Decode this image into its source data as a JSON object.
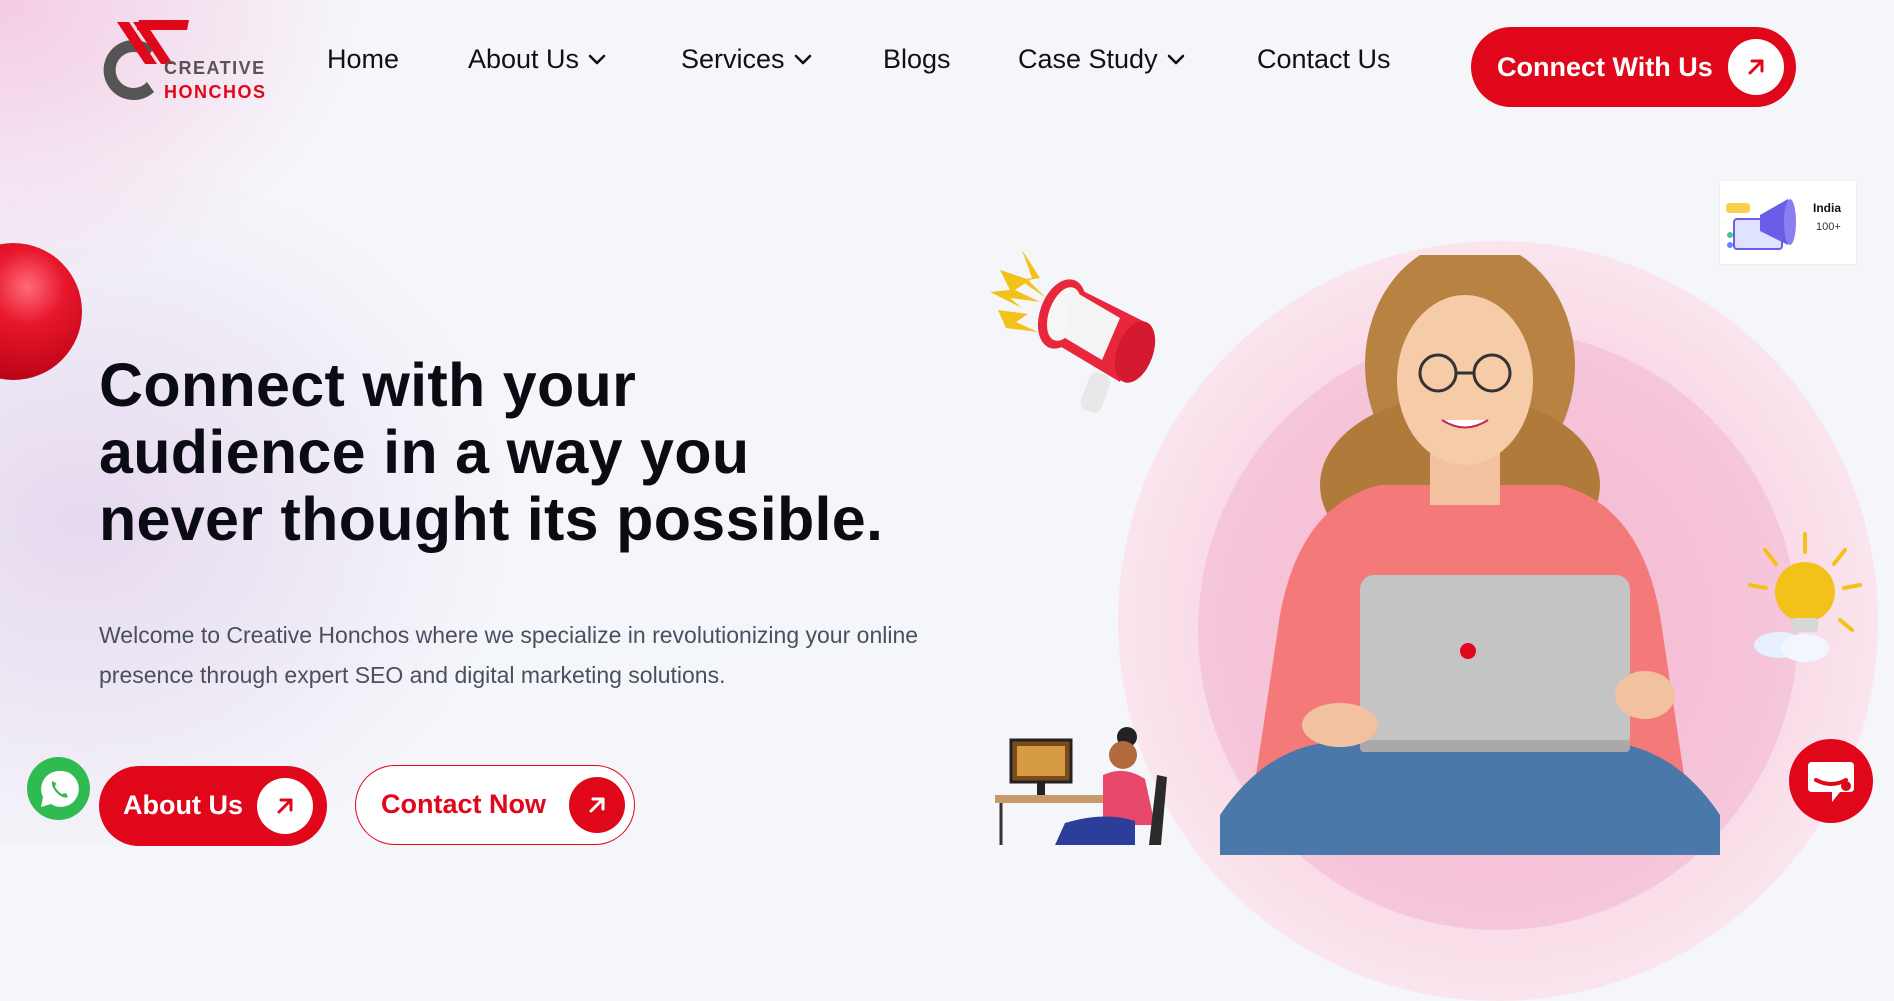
{
  "brand": {
    "name_line1": "CREATIVE",
    "name_line2": "HONCHOS",
    "accent_color": "#e0071b",
    "icon": "creative-honchos-logo"
  },
  "nav": {
    "items": [
      {
        "label": "Home",
        "has_dropdown": false
      },
      {
        "label": "About Us",
        "has_dropdown": true
      },
      {
        "label": "Services",
        "has_dropdown": true
      },
      {
        "label": "Blogs",
        "has_dropdown": false
      },
      {
        "label": "Case Study",
        "has_dropdown": true
      },
      {
        "label": "Contact Us",
        "has_dropdown": false
      }
    ],
    "cta_label": "Connect With Us",
    "cta_icon": "arrow-up-right-icon"
  },
  "hero": {
    "title_lines": [
      "Connect with your",
      "audience in a way you",
      "never thought its possible."
    ],
    "description": "Welcome to Creative Honchos where we specialize in revolutionizing your online presence through expert SEO and digital marketing solutions.",
    "primary_button": "About Us",
    "secondary_button": "Contact Now",
    "title_color": "#0b0b14",
    "text_color": "#4a4f60"
  },
  "badge": {
    "country": "India",
    "count": "100+"
  },
  "widgets": {
    "whatsapp_icon": "whatsapp-icon",
    "whatsapp_color": "#2fbb4f",
    "chat_icon": "chat-bubble-icon"
  }
}
